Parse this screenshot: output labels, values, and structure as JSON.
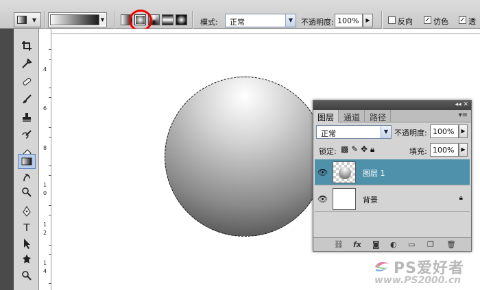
{
  "options_bar": {
    "mode_label": "模式:",
    "mode_value": "正常",
    "opacity_label": "不透明度:",
    "opacity_value": "100%",
    "reverse_label": "反向",
    "dither_label": "仿色",
    "transparency_label": "透",
    "reverse_checked": false,
    "dither_checked": true,
    "transparency_checked": true,
    "selected_gradient_type": "radial",
    "gradient_types": [
      "linear",
      "radial",
      "angle",
      "reflected",
      "diamond"
    ]
  },
  "toolbox": {
    "tools": [
      "crop-tool",
      "eyedropper-tool",
      "healing-brush-tool",
      "brush-tool",
      "clone-stamp-tool",
      "history-brush-tool",
      "eraser-tool",
      "gradient-tool",
      "smudge-tool",
      "dodge-tool",
      "pen-tool",
      "type-tool",
      "path-selection-tool",
      "custom-shape-tool",
      "zoom-tool"
    ],
    "active_tool": "gradient-tool",
    "type_tool_glyph": "T"
  },
  "ruler": {
    "labels": [
      "4",
      "6",
      "8",
      "1",
      "0",
      "1",
      "2",
      "1",
      "4"
    ]
  },
  "layers_panel": {
    "tabs": [
      "图层",
      "通道",
      "路径"
    ],
    "active_tab": "图层",
    "blend_mode": "正常",
    "opacity_label": "不透明度:",
    "opacity_value": "100%",
    "lock_label": "锁定:",
    "fill_label": "填充:",
    "fill_value": "100%",
    "layers": [
      {
        "name": "图层 1",
        "visible": true,
        "selected": true,
        "locked": false
      },
      {
        "name": "背景",
        "visible": true,
        "selected": false,
        "locked": true
      }
    ],
    "bottom_icons": [
      "link-icon",
      "fx-icon",
      "mask-icon",
      "adjustment-icon",
      "group-icon",
      "new-layer-icon",
      "trash-icon"
    ]
  },
  "watermark": {
    "brand": "PS爱好者",
    "url": "www.PS2000.cn"
  },
  "colors": {
    "selected_layer": "#4f91aa",
    "highlight_circle": "#e00000"
  }
}
